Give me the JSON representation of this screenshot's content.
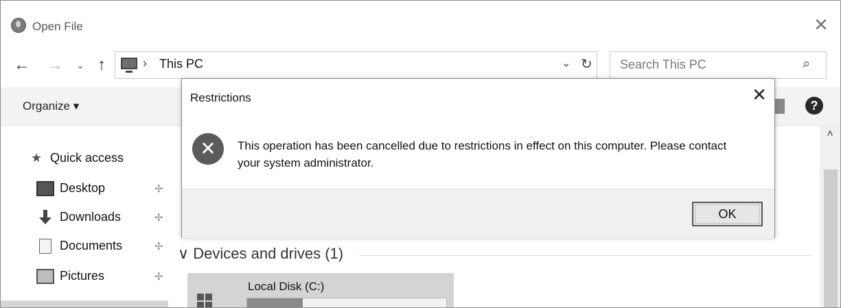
{
  "window": {
    "title": "Open File",
    "close_glyph": "✕"
  },
  "nav": {
    "back_glyph": "←",
    "forward_glyph": "→",
    "recent_glyph": "⌄",
    "up_glyph": "↑",
    "address_separator": "›",
    "address_path": "This PC",
    "address_dropdown_glyph": "⌄",
    "refresh_glyph": "↻"
  },
  "search": {
    "placeholder": "Search This PC",
    "icon_glyph": "⌕"
  },
  "toolbar": {
    "organize_label": "Organize ▾",
    "help_glyph": "?"
  },
  "sidebar": {
    "quick_access_label": "Quick access",
    "items": [
      {
        "label": "Desktop",
        "icon": "desktop-icon"
      },
      {
        "label": "Downloads",
        "icon": "download-arrow-icon"
      },
      {
        "label": "Documents",
        "icon": "document-icon"
      },
      {
        "label": "Pictures",
        "icon": "pictures-icon"
      }
    ],
    "pin_glyph": "✢"
  },
  "content": {
    "group_header": "Devices and drives (1)",
    "group_chevron": "∨",
    "drive": {
      "name": "Local Disk (C:)",
      "usage_fraction": 0.28
    },
    "scroll_up_glyph": "˄"
  },
  "dialog": {
    "title": "Restrictions",
    "close_glyph": "✕",
    "error_glyph": "✕",
    "message": "This operation has been cancelled due to restrictions in effect on this computer. Please contact your system administrator.",
    "ok_label": "OK"
  }
}
